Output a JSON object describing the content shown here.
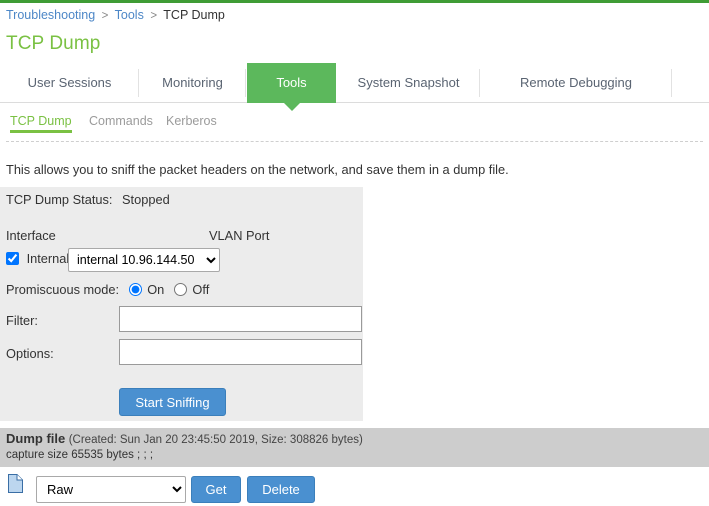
{
  "theme": {
    "top_rule_color": "#3f9c35",
    "accent_green": "#7ac143",
    "active_tab_green": "#5cb85c",
    "link_blue": "#4d87c7",
    "button_blue": "#4a90d0",
    "panel_gray": "#ececec",
    "dumpbar_gray": "#cdcdcd"
  },
  "breadcrumb": {
    "items": [
      {
        "label": "Troubleshooting",
        "link": true
      },
      {
        "label": "Tools",
        "link": true
      },
      {
        "label": "TCP Dump",
        "link": false
      }
    ],
    "separator": ">"
  },
  "page_title": "TCP Dump",
  "main_tabs": [
    {
      "label": "User Sessions",
      "active": false
    },
    {
      "label": "Monitoring",
      "active": false
    },
    {
      "label": "Tools",
      "active": true
    },
    {
      "label": "System Snapshot",
      "active": false
    },
    {
      "label": "Remote Debugging",
      "active": false
    }
  ],
  "sub_tabs": [
    {
      "label": "TCP Dump",
      "active": true
    },
    {
      "label": "Commands",
      "active": false
    },
    {
      "label": "Kerberos",
      "active": false
    }
  ],
  "description": "This allows you to sniff the packet headers on the network, and save them in a dump file.",
  "form": {
    "status_label": "TCP Dump Status:",
    "status_value": "Stopped",
    "interface_header": "Interface",
    "vlan_port_header": "VLAN Port",
    "interface_checkbox_label": "Internal",
    "interface_checked": true,
    "interface_selected": "internal 10.96.144.50",
    "interface_options": [
      "internal 10.96.144.50"
    ],
    "promiscuous_label": "Promiscuous mode:",
    "promiscuous_on_label": "On",
    "promiscuous_off_label": "Off",
    "promiscuous_value": "On",
    "filter_label": "Filter:",
    "filter_value": "",
    "filter_placeholder": "",
    "options_label": "Options:",
    "options_value": "",
    "options_placeholder": "",
    "start_button": "Start Sniffing"
  },
  "dump_file": {
    "title": "Dump file",
    "meta": "(Created: Sun Jan 20 23:45:50 2019, Size: 308826 bytes)",
    "detail": "capture size 65535 bytes ; ; ;",
    "file_icon": "file-icon",
    "format_selected": "Raw",
    "format_options": [
      "Raw"
    ],
    "get_button": "Get",
    "delete_button": "Delete"
  }
}
